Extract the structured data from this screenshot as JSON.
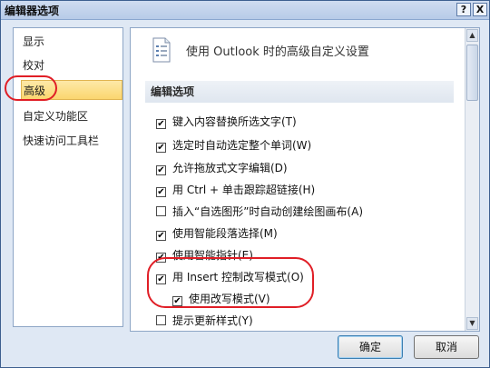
{
  "window": {
    "title": "编辑器选项",
    "help": "?",
    "close": "X"
  },
  "nav": {
    "items": [
      {
        "label": "显示"
      },
      {
        "label": "校对"
      },
      {
        "label": "高级"
      },
      {
        "label": "自定义功能区"
      },
      {
        "label": "快速访问工具栏"
      }
    ],
    "selected": "高级"
  },
  "panel": {
    "header": "使用 Outlook 时的高级自定义设置",
    "section": "编辑选项",
    "options": [
      {
        "label": "键入内容替换所选文字(T)",
        "checked": true
      },
      {
        "label": "选定时自动选定整个单词(W)",
        "checked": true
      },
      {
        "label": "允许拖放式文字编辑(D)",
        "checked": true
      },
      {
        "label": "用 Ctrl + 单击跟踪超链接(H)",
        "checked": true
      },
      {
        "label": "插入“自选图形”时自动创建绘图画布(A)",
        "checked": false
      },
      {
        "label": "使用智能段落选择(M)",
        "checked": true
      },
      {
        "label": "使用智能指针(E)",
        "checked": true
      },
      {
        "label": "用 Insert 控制改写模式(O)",
        "checked": true
      },
      {
        "label": "使用改写模式(V)",
        "checked": true
      },
      {
        "label": "提示更新样式(Y)",
        "checked": false
      }
    ],
    "check_glyph": "✔"
  },
  "buttons": {
    "ok": "确定",
    "cancel": "取消"
  },
  "colors": {
    "annotation": "#e01e26",
    "selection": "#fbd66f"
  }
}
